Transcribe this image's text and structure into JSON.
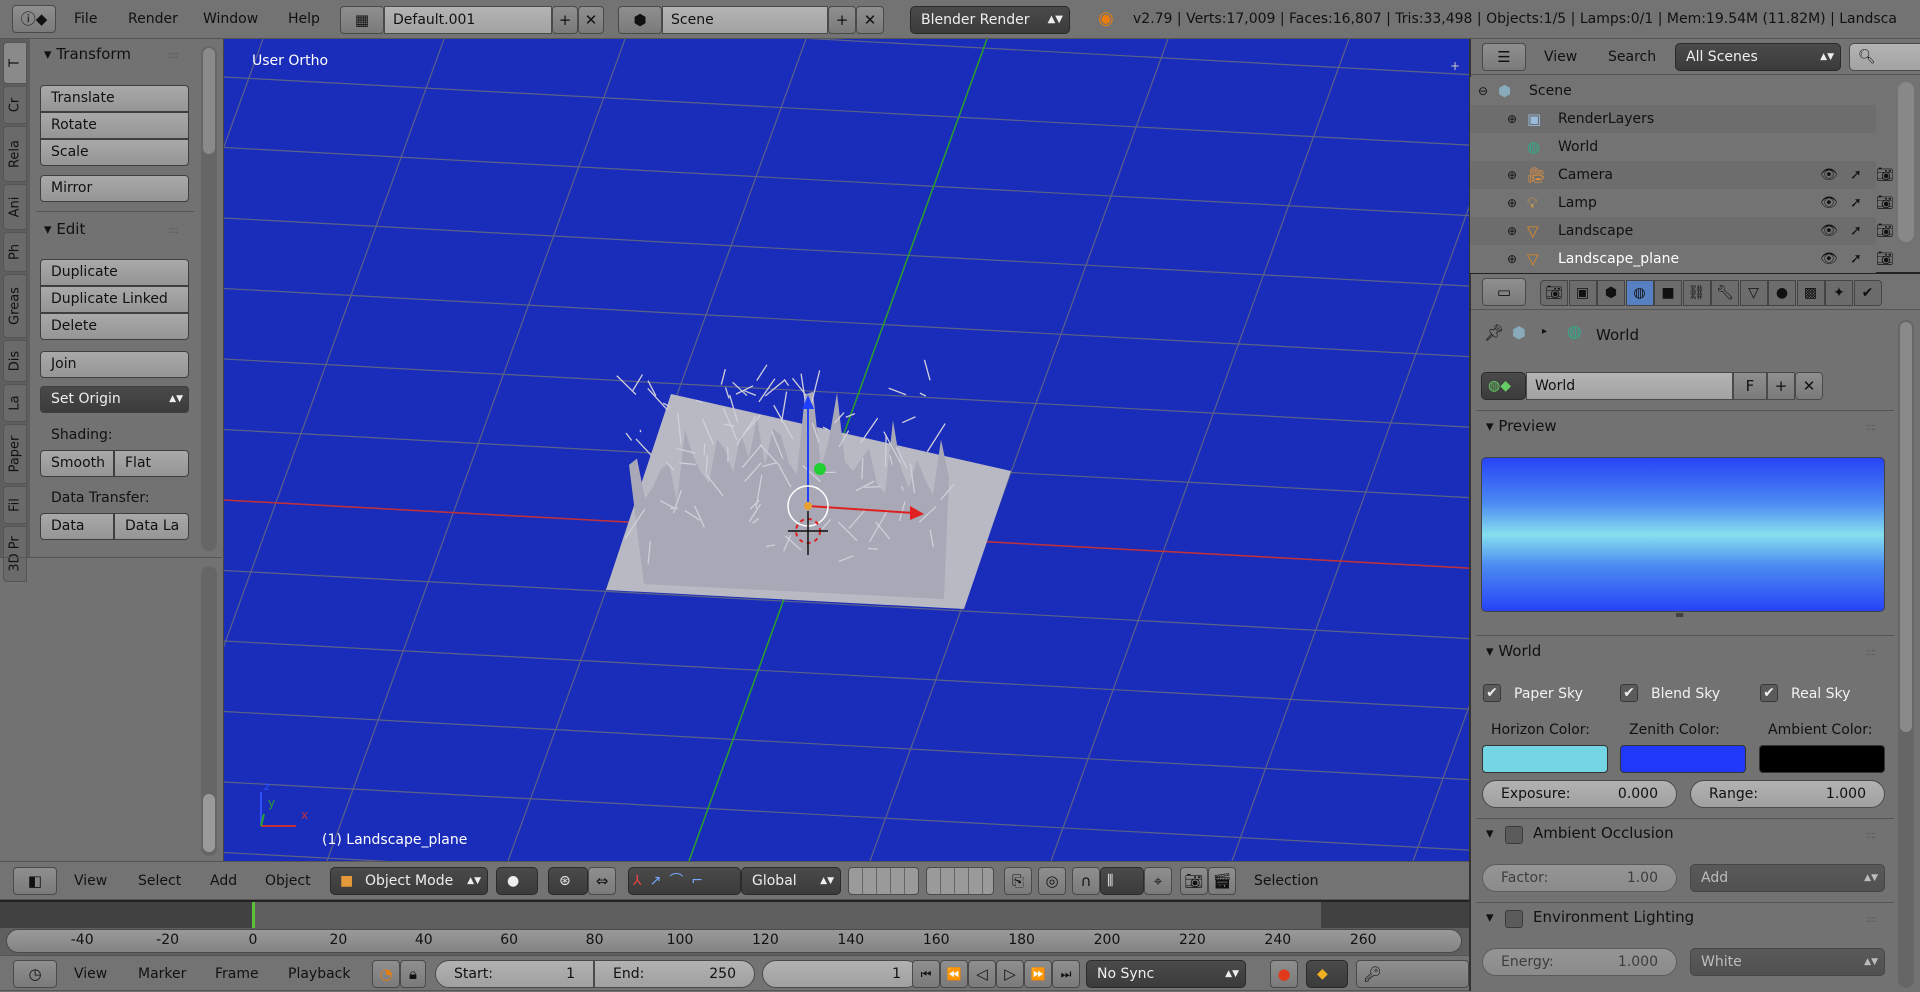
{
  "topbar": {
    "menus": [
      "File",
      "Render",
      "Window",
      "Help"
    ],
    "layout": "Default.001",
    "scene": "Scene",
    "engine": "Blender Render",
    "stats": "v2.79 | Verts:17,009 | Faces:16,807 | Tris:33,498 | Objects:1/5 | Lamps:0/1 | Mem:19.54M (11.82M) | Landsca"
  },
  "toolshelf": {
    "tabs": [
      "T",
      "Cr",
      "Rela",
      "Ani",
      "Ph",
      "Greas",
      "Dis",
      "La",
      "Paper",
      "Fil",
      "3D Pr"
    ],
    "transform": {
      "title": "Transform",
      "buttons": [
        "Translate",
        "Rotate",
        "Scale",
        "Mirror"
      ]
    },
    "edit": {
      "title": "Edit",
      "buttons": [
        "Duplicate",
        "Duplicate Linked",
        "Delete",
        "Join"
      ],
      "set_origin": "Set Origin",
      "shading_label": "Shading:",
      "smooth": "Smooth",
      "flat": "Flat",
      "data_transfer_label": "Data Transfer:",
      "data": "Data",
      "data_layers": "Data La"
    }
  },
  "viewport": {
    "view_name": "User Ortho",
    "object_label": "(1) Landscape_plane",
    "axis": {
      "x": "x",
      "y": "y",
      "z": "z"
    },
    "colors": {
      "background": "#1a2cba",
      "x_axis": "#c0303a",
      "y_axis": "#2aa02a"
    }
  },
  "view3d_header": {
    "menus": [
      "View",
      "Select",
      "Add",
      "Object"
    ],
    "mode": "Object Mode",
    "orientation": "Global",
    "selection_label": "Selection"
  },
  "timeline": {
    "ticks": [
      -40,
      -20,
      0,
      20,
      40,
      60,
      80,
      100,
      120,
      140,
      160,
      180,
      200,
      220,
      240,
      260
    ],
    "current_frame": 1,
    "start": 1,
    "end": 250
  },
  "timeline_header": {
    "menus": [
      "View",
      "Marker",
      "Frame",
      "Playback"
    ],
    "start_label": "Start:",
    "start_value": "1",
    "end_label": "End:",
    "end_value": "250",
    "current": "1",
    "sync": "No Sync"
  },
  "outliner": {
    "menus": [
      "View",
      "Search"
    ],
    "filter": "All Scenes",
    "rows": [
      {
        "name": "Scene",
        "icon": "scene-icon"
      },
      {
        "name": "RenderLayers",
        "icon": "render-layers-icon"
      },
      {
        "name": "World",
        "icon": "world-icon"
      },
      {
        "name": "Camera",
        "icon": "camera-icon"
      },
      {
        "name": "Lamp",
        "icon": "lamp-icon"
      },
      {
        "name": "Landscape",
        "icon": "mesh-icon"
      },
      {
        "name": "Landscape_plane",
        "icon": "mesh-icon"
      }
    ]
  },
  "properties": {
    "breadcrumb": "World",
    "datablock": {
      "name": "World",
      "fake_user": "F"
    },
    "preview_title": "Preview",
    "world_title": "World",
    "checks": [
      {
        "label": "Paper Sky",
        "checked": true
      },
      {
        "label": "Blend Sky",
        "checked": true
      },
      {
        "label": "Real Sky",
        "checked": true
      }
    ],
    "colors": [
      {
        "label": "Horizon Color:",
        "value": "#74d6e4"
      },
      {
        "label": "Zenith Color:",
        "value": "#2038f8"
      },
      {
        "label": "Ambient Color:",
        "value": "#000000"
      }
    ],
    "exposure": {
      "label": "Exposure:",
      "value": "0.000"
    },
    "range": {
      "label": "Range:",
      "value": "1.000"
    },
    "ao": {
      "title": "Ambient Occlusion",
      "enabled": false,
      "factor_label": "Factor:",
      "factor": "1.00",
      "blend": "Add"
    },
    "env": {
      "title": "Environment Lighting",
      "enabled": false,
      "energy_label": "Energy:",
      "energy": "1.000",
      "color": "White"
    }
  }
}
